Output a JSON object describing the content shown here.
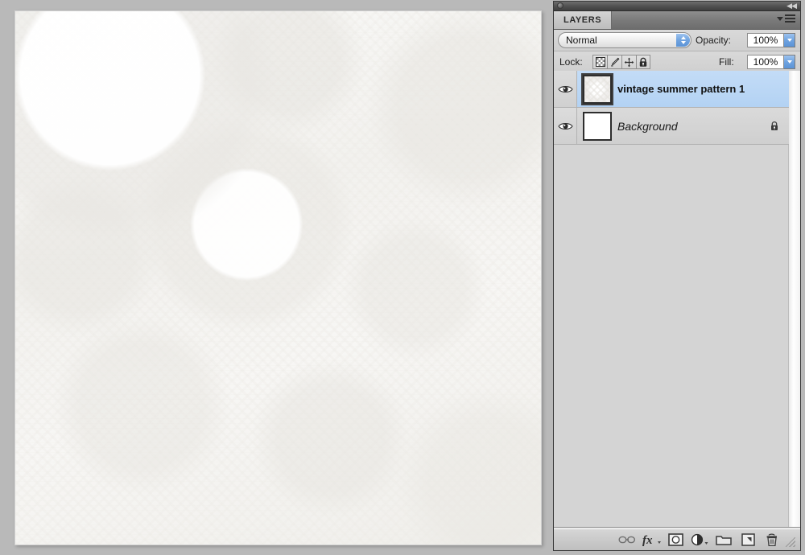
{
  "window": {
    "panel_title": "LAYERS",
    "collapse_label": "◀◀",
    "menu_icon": "panel-menu-icon"
  },
  "blend": {
    "mode_label": "Normal",
    "opacity_label": "Opacity:",
    "opacity_value": "100%",
    "fill_label": "Fill:",
    "fill_value": "100%"
  },
  "lock": {
    "label": "Lock:",
    "buttons": [
      {
        "name": "lock-transparent-pixels-icon",
        "title": "Lock transparent pixels"
      },
      {
        "name": "lock-image-pixels-icon",
        "title": "Lock image pixels"
      },
      {
        "name": "lock-position-icon",
        "title": "Lock position"
      },
      {
        "name": "lock-all-icon",
        "title": "Lock all"
      }
    ]
  },
  "layers": [
    {
      "name": "vintage summer pattern 1",
      "visible": true,
      "selected": true,
      "locked": false,
      "style": "bold",
      "thumbnail": "pattern-thumbnail"
    },
    {
      "name": "Background",
      "visible": true,
      "selected": false,
      "locked": true,
      "style": "italic",
      "thumbnail": "white-thumbnail"
    }
  ],
  "bottom_toolbar": [
    {
      "name": "link-layers-icon",
      "label": "Link layers"
    },
    {
      "name": "layer-style-fx-icon",
      "label": "Add a layer style"
    },
    {
      "name": "layer-mask-icon",
      "label": "Add layer mask"
    },
    {
      "name": "adjustment-layer-icon",
      "label": "Create new fill or adjustment layer"
    },
    {
      "name": "new-group-icon",
      "label": "Create a new group"
    },
    {
      "name": "new-layer-icon",
      "label": "Create a new layer"
    },
    {
      "name": "delete-layer-icon",
      "label": "Delete layer"
    }
  ],
  "colors": {
    "selection_blue": "#b3d2f3",
    "panel_gray": "#d4d4d4",
    "workspace_gray": "#b9b9b9",
    "widget_blue": "#6fa3e0"
  },
  "document": {
    "canvas_label": "document-canvas"
  }
}
